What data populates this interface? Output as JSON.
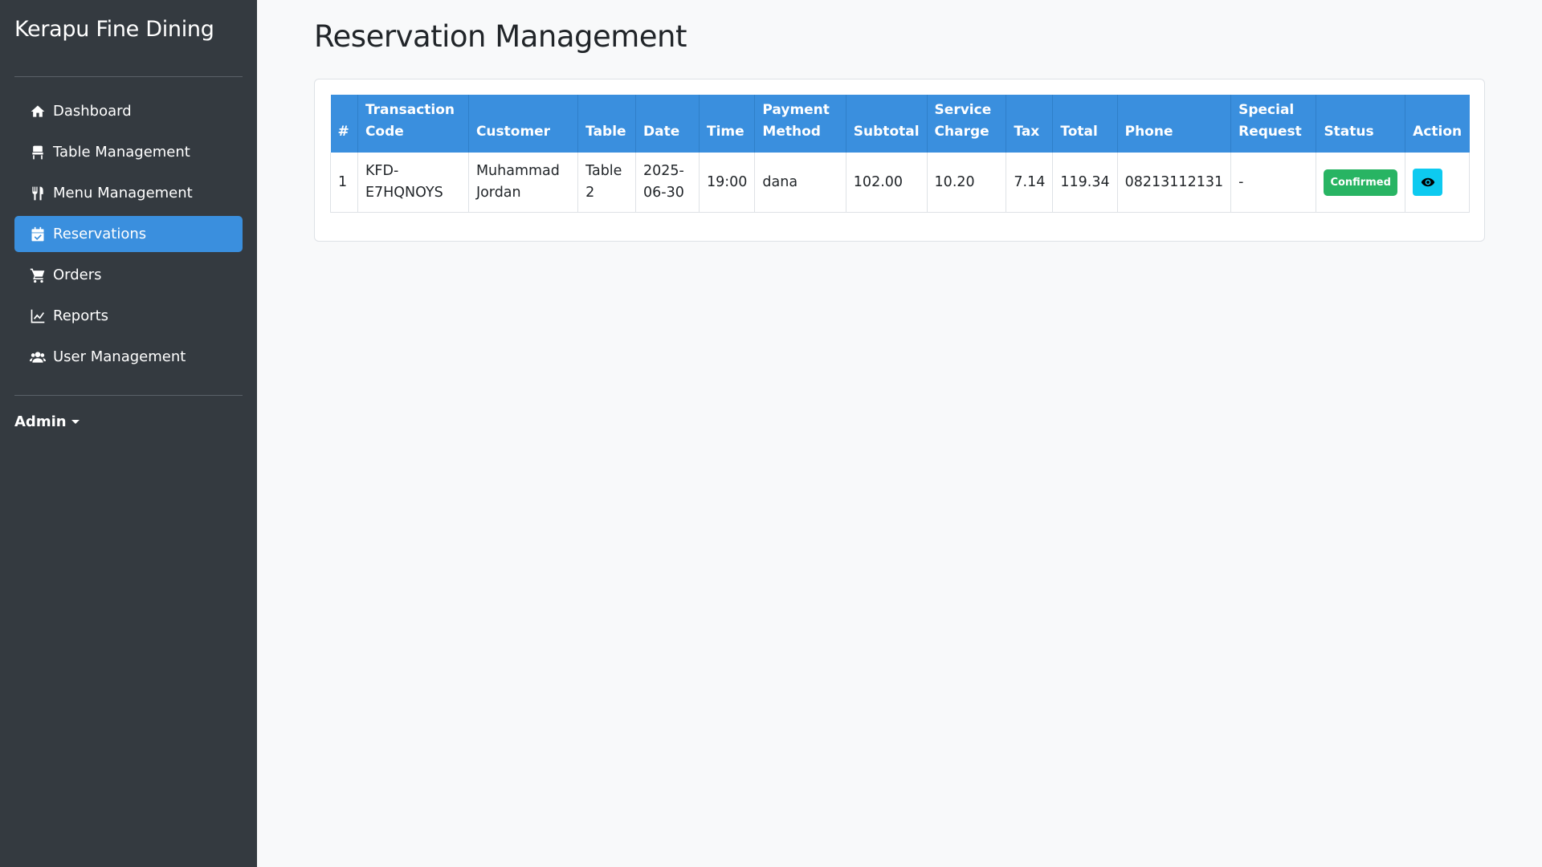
{
  "sidebar": {
    "brand": "Kerapu Fine Dining",
    "items": [
      {
        "label": "Dashboard",
        "icon": "home-icon"
      },
      {
        "label": "Table Management",
        "icon": "chair-icon"
      },
      {
        "label": "Menu Management",
        "icon": "utensils-icon"
      },
      {
        "label": "Reservations",
        "icon": "calendar-check-icon",
        "active": true
      },
      {
        "label": "Orders",
        "icon": "cart-icon"
      },
      {
        "label": "Reports",
        "icon": "line-chart-icon"
      },
      {
        "label": "User Management",
        "icon": "users-icon"
      }
    ],
    "admin_label": "Admin"
  },
  "main": {
    "title": "Reservation Management",
    "table": {
      "headers": [
        "#",
        "Transaction Code",
        "Customer",
        "Table",
        "Date",
        "Time",
        "Payment Method",
        "Subtotal",
        "Service Charge",
        "Tax",
        "Total",
        "Phone",
        "Special Request",
        "Status",
        "Action"
      ],
      "rows": [
        {
          "no": "1",
          "code": "KFD-E7HQNOYS",
          "customer": "Muhammad Jordan",
          "table": "Table 2",
          "date": "2025-06-30",
          "time": "19:00",
          "payment": "dana",
          "subtotal": "102.00",
          "service": "10.20",
          "tax": "7.14",
          "total": "119.34",
          "phone": "08213112131",
          "special": "-",
          "status": "Confirmed",
          "action_icon": "eye-icon"
        }
      ]
    }
  },
  "colors": {
    "sidebar_bg": "#343a40",
    "accent": "#3a8fde",
    "status_confirmed": "#28b463",
    "action_button": "#0dcaf0"
  }
}
